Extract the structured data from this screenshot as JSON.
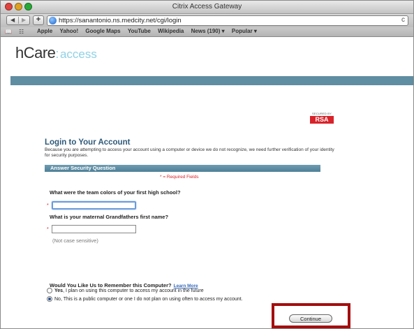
{
  "window": {
    "title": "Citrix Access Gateway"
  },
  "toolbar": {
    "back_glyph": "◀",
    "forward_glyph": "▶",
    "add_glyph": "+",
    "url": "https://sanantonio.ns.medcity.net/cgi/login",
    "reload_glyph": "c"
  },
  "bookmarks": {
    "items": [
      "Apple",
      "Yahoo!",
      "Google Maps",
      "YouTube",
      "Wikipedia",
      "News (190) ▾",
      "Popular ▾"
    ]
  },
  "brand": {
    "name": "hCare",
    "dots": ":",
    "suffix": "access"
  },
  "rsa": {
    "secured_by": "SECURED BY",
    "logo": "RSA"
  },
  "form": {
    "title": "Login to Your Account",
    "description": "Because you are attempting to access your account using a computer or device we do not recognize, we need further verification of your identity for security purposes.",
    "section_title": "Answer Security Question",
    "required_note": "* = Required Fields",
    "required_star": "*",
    "question1": "What were the team colors of your first high school?",
    "answer1": "",
    "question2": "What is your maternal Grandfathers first name?",
    "answer2": "",
    "hint": "(Not case sensitive)"
  },
  "remember": {
    "question": "Would You Like Us to Remember this Computer?",
    "learn_more": "Learn More",
    "option_yes_bold": "Yes",
    "option_yes_rest": ", I plan on using this computer to access my account in the future",
    "option_no": "No, This is a public computer or one I do not plan on using often to access my account.",
    "selected": "no"
  },
  "actions": {
    "continue_label": "Continue"
  },
  "colors": {
    "accent": "#5f8da2",
    "title_blue": "#2f5a79",
    "required_red": "#d8232a",
    "highlight_red": "#a30e0e"
  }
}
